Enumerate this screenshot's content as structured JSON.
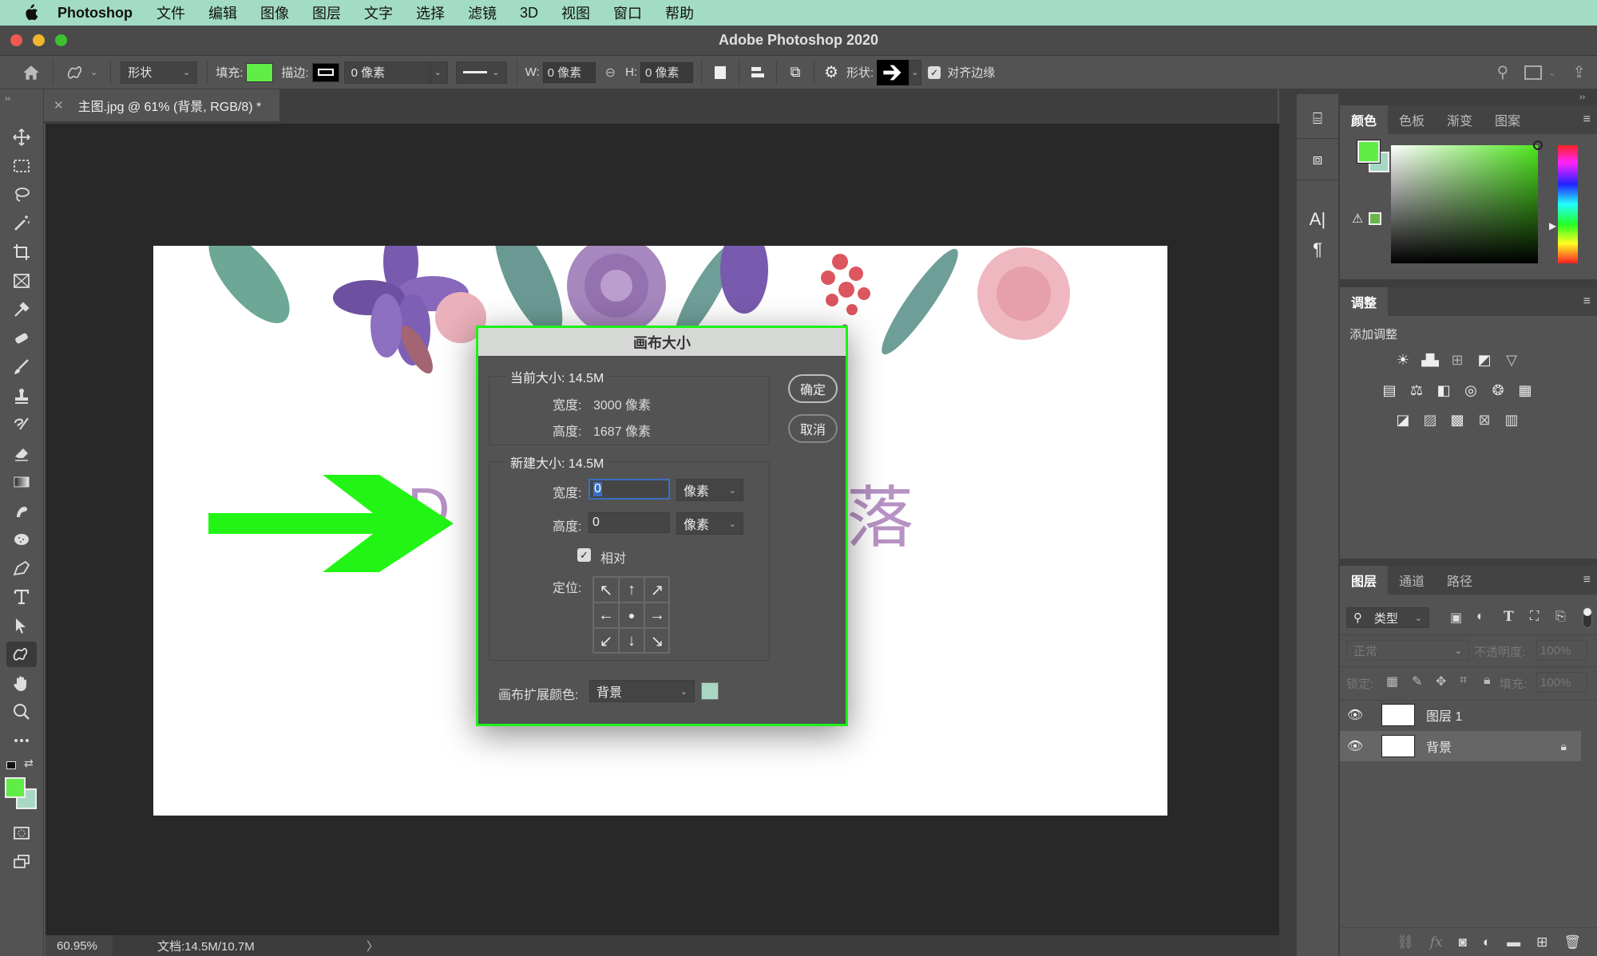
{
  "menubar": {
    "app": "Photoshop",
    "items": [
      "文件",
      "编辑",
      "图像",
      "图层",
      "文字",
      "选择",
      "滤镜",
      "3D",
      "视图",
      "窗口",
      "帮助"
    ]
  },
  "window": {
    "title": "Adobe Photoshop 2020"
  },
  "options": {
    "mode": "形状",
    "fill_label": "填充:",
    "fill_color": "#5fed46",
    "stroke_label": "描边:",
    "stroke_width": "0 像素",
    "w_label": "W:",
    "w_value": "0 像素",
    "h_label": "H:",
    "h_value": "0 像素",
    "shape_label": "形状:",
    "align_edges_label": "对齐边缘",
    "align_edges_checked": true
  },
  "document": {
    "tab_title": "主图.jpg @ 61% (背景, RGB/8) *",
    "canvas_text_left": "D",
    "canvas_text_right": "落"
  },
  "status": {
    "zoom": "60.95%",
    "doc_info": "文档:14.5M/10.7M",
    "arrow": "〉"
  },
  "dialog": {
    "title": "画布大小",
    "current_size_label": "当前大小: 14.5M",
    "current_width_label": "宽度:",
    "current_width_value": "3000 像素",
    "current_height_label": "高度:",
    "current_height_value": "1687 像素",
    "new_size_label": "新建大小: 14.5M",
    "new_width_label": "宽度:",
    "new_width_value": "0",
    "new_height_label": "高度:",
    "new_height_value": "0",
    "unit": "像素",
    "relative_label": "相对",
    "relative_checked": true,
    "anchor_label": "定位:",
    "anchor_arrows": [
      "↖",
      "↑",
      "↗",
      "←",
      "●",
      "→",
      "↙",
      "↓",
      "↘"
    ],
    "ext_color_label": "画布扩展颜色:",
    "ext_color_value": "背景",
    "ext_color_swatch": "#a8d8c4",
    "ok": "确定",
    "cancel": "取消"
  },
  "panels": {
    "color_tabs": [
      "颜色",
      "色板",
      "渐变",
      "图案"
    ],
    "foreground": "#5fed46",
    "background": "#a8d8c4",
    "adjust_tab": "调整",
    "add_adjust": "添加调整",
    "layer_tabs": [
      "图层",
      "通道",
      "路径"
    ],
    "filter_kind": "类型",
    "blend_mode": "正常",
    "opacity_label": "不透明度:",
    "opacity_value": "100%",
    "lock_label": "锁定:",
    "fill_label": "填充:",
    "fill_value": "100%",
    "layers": [
      {
        "name": "图层 1",
        "visible": true,
        "locked": false,
        "selected": false
      },
      {
        "name": "背景",
        "visible": true,
        "locked": true,
        "selected": true
      }
    ]
  },
  "colors": {
    "menubar": "#a3dcc4",
    "dialog_border": "#1ef01a",
    "arrow_shape": "#22f515",
    "canvas_text": "#b792c4"
  }
}
